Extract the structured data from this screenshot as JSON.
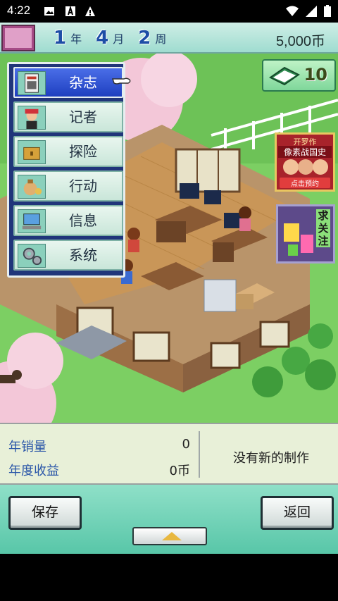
{
  "status_bar": {
    "time": "4:22",
    "icons": [
      "image-icon",
      "a-icon",
      "warning-icon"
    ],
    "right_icons": [
      "wifi-icon",
      "signal-icon",
      "battery-icon"
    ]
  },
  "header": {
    "year_num": "1",
    "year_unit": "年",
    "month_num": "4",
    "month_unit": "月",
    "week_num": "2",
    "week_unit": "周",
    "money": "5,000币"
  },
  "books": {
    "count": "10"
  },
  "menu": {
    "items": [
      {
        "label": "杂志",
        "icon": "magazine-icon",
        "selected": true
      },
      {
        "label": "记者",
        "icon": "reporter-icon",
        "selected": false
      },
      {
        "label": "探险",
        "icon": "treasure-chest-icon",
        "selected": false
      },
      {
        "label": "行动",
        "icon": "money-bag-icon",
        "selected": false
      },
      {
        "label": "信息",
        "icon": "computer-icon",
        "selected": false
      },
      {
        "label": "系统",
        "icon": "gears-icon",
        "selected": false
      }
    ]
  },
  "ads": {
    "ad1": {
      "line1": "开罗作",
      "line2": "像素战国史",
      "line3": "点击预约"
    },
    "ad2": {
      "vertical": "求关注"
    }
  },
  "info": {
    "annual_sales_label": "年销量",
    "annual_sales_value": "0",
    "annual_revenue_label": "年度收益",
    "annual_revenue_value": "0币",
    "no_production": "没有新的制作"
  },
  "controls": {
    "save": "保存",
    "back": "返回"
  },
  "colors": {
    "menu_bg": "#20357a",
    "selected_item": "#1e3fbf",
    "controls_bg": "#58c6a8",
    "info_label": "#2a56a8"
  }
}
